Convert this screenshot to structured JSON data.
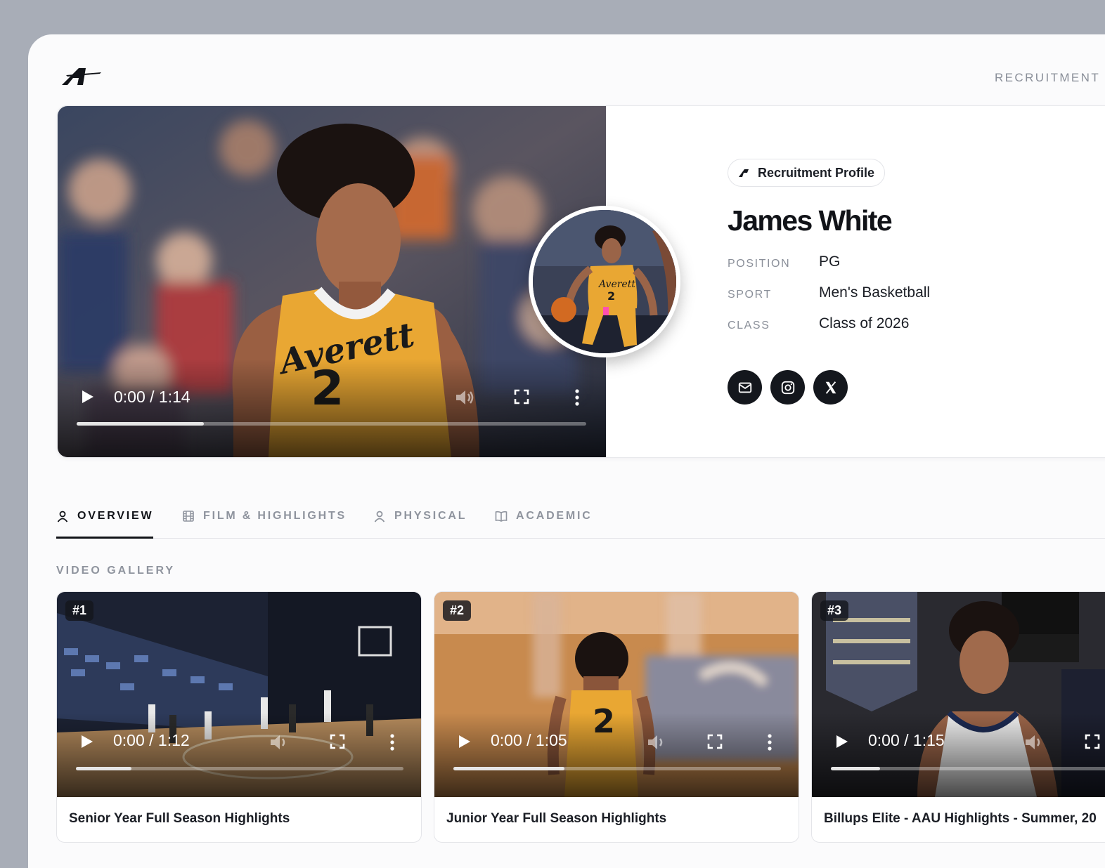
{
  "header": {
    "logo_icon": "brand-logo",
    "nav_label": "RECRUITMENT P"
  },
  "hero": {
    "video": {
      "time": "0:00 / 1:14",
      "progress": 0.25
    },
    "badge_label": "Recruitment Profile",
    "name": "James White",
    "info": [
      {
        "label": "POSITION",
        "value": "PG"
      },
      {
        "label": "SPORT",
        "value": "Men's Basketball"
      },
      {
        "label": "CLASS",
        "value": "Class of 2026"
      }
    ],
    "socials": [
      "mail-icon",
      "instagram-icon",
      "x-icon"
    ]
  },
  "tabs": [
    {
      "label": "OVERVIEW",
      "icon": "user-icon",
      "active": true
    },
    {
      "label": "FILM & HIGHLIGHTS",
      "icon": "film-icon",
      "active": false
    },
    {
      "label": "PHYSICAL",
      "icon": "user-icon",
      "active": false
    },
    {
      "label": "ACADEMIC",
      "icon": "book-icon",
      "active": false
    }
  ],
  "gallery": {
    "title": "VIDEO GALLERY",
    "videos": [
      {
        "rank": "#1",
        "time": "0:00 / 1:12",
        "progress": 0.17,
        "title": "Senior Year Full Season Highlights"
      },
      {
        "rank": "#2",
        "time": "0:00 / 1:05",
        "progress": 0.34,
        "title": "Junior Year Full Season Highlights"
      },
      {
        "rank": "#3",
        "time": "0:00 / 1:15",
        "progress": 0.15,
        "title": "Billups Elite - AAU Highlights - Summer, 20"
      }
    ]
  },
  "colors": {
    "page_bg": "#a8adb7",
    "jersey": "#e9a733",
    "dark": "#14171d"
  }
}
